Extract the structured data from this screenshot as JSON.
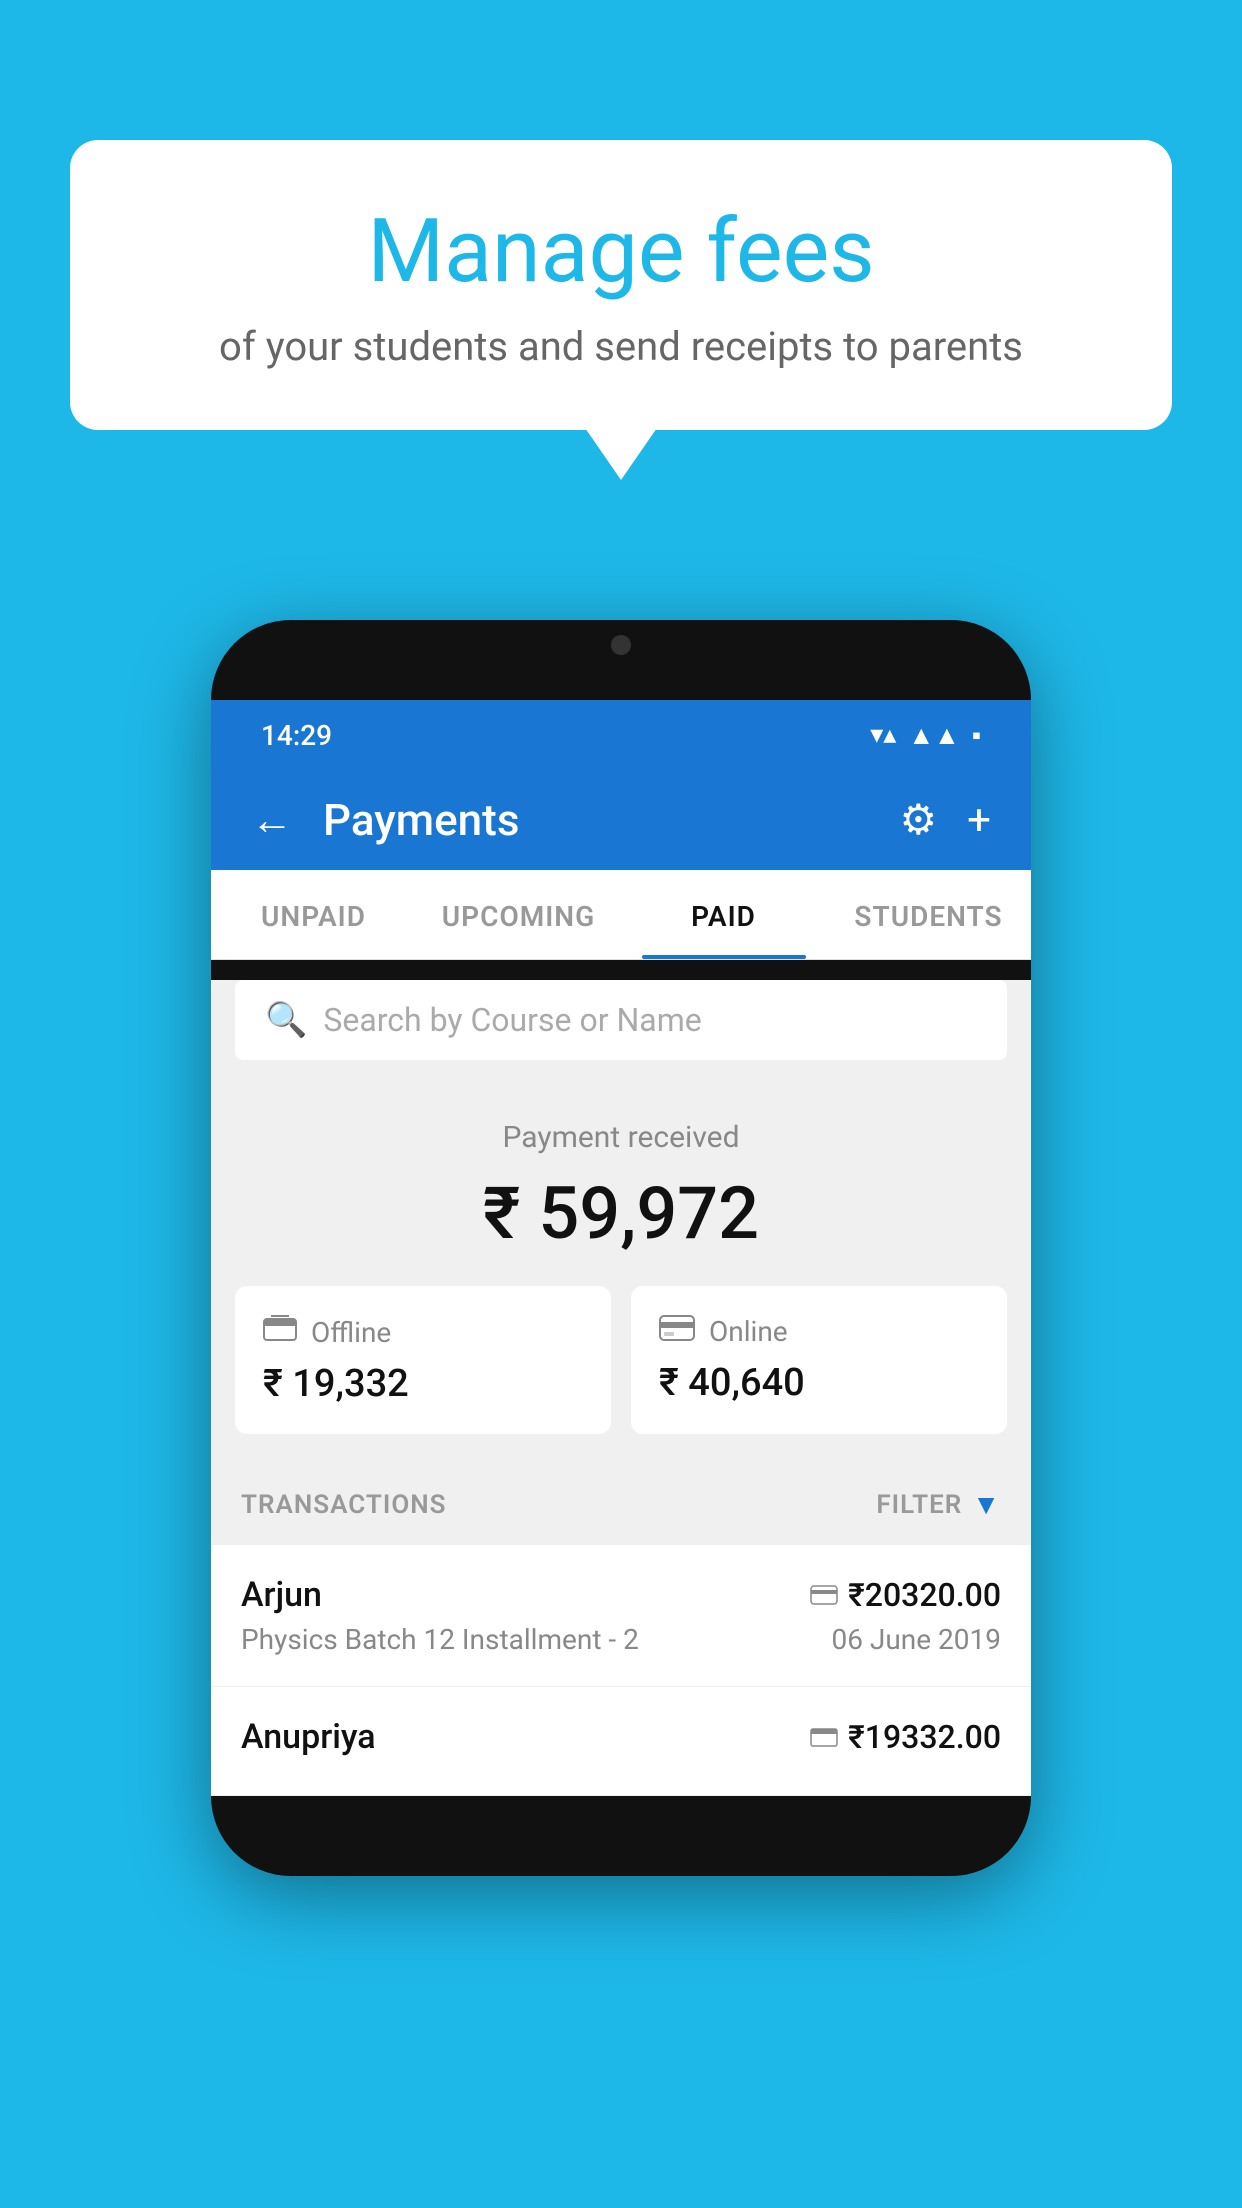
{
  "background_color": "#1eb8e8",
  "bubble": {
    "title": "Manage fees",
    "subtitle": "of your students and send receipts to parents"
  },
  "phone": {
    "status_bar": {
      "time": "14:29",
      "wifi": "▼",
      "signal": "▲",
      "battery": "▪"
    },
    "header": {
      "title": "Payments",
      "back_label": "←",
      "settings_label": "⚙",
      "add_label": "+"
    },
    "tabs": [
      {
        "id": "unpaid",
        "label": "UNPAID",
        "active": false
      },
      {
        "id": "upcoming",
        "label": "UPCOMING",
        "active": false
      },
      {
        "id": "paid",
        "label": "PAID",
        "active": true
      },
      {
        "id": "students",
        "label": "STUDENTS",
        "active": false
      }
    ],
    "search": {
      "placeholder": "Search by Course or Name"
    },
    "payment_received": {
      "label": "Payment received",
      "amount": "₹ 59,972"
    },
    "payment_cards": [
      {
        "id": "offline",
        "icon": "💳",
        "label": "Offline",
        "amount": "₹ 19,332"
      },
      {
        "id": "online",
        "icon": "💳",
        "label": "Online",
        "amount": "₹ 40,640"
      }
    ],
    "transactions": {
      "header_label": "TRANSACTIONS",
      "filter_label": "FILTER",
      "items": [
        {
          "name": "Arjun",
          "course": "Physics Batch 12 Installment - 2",
          "amount": "₹20320.00",
          "date": "06 June 2019",
          "mode": "online"
        },
        {
          "name": "Anupriya",
          "course": "",
          "amount": "₹19332.00",
          "date": "",
          "mode": "offline"
        }
      ]
    }
  }
}
